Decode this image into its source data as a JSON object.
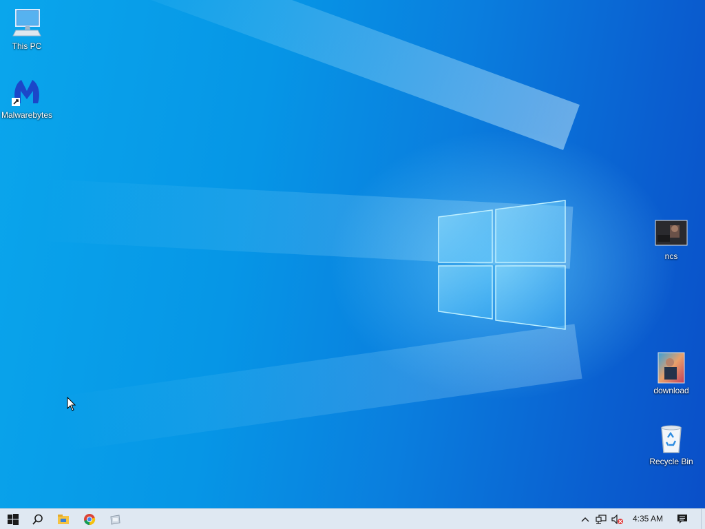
{
  "desktop": {
    "icons": [
      {
        "label": "This PC",
        "icon": "computer-monitor-icon"
      },
      {
        "label": "Malwarebytes",
        "icon": "malwarebytes-icon"
      },
      {
        "label": "ncs",
        "icon": "image-thumbnail-icon"
      },
      {
        "label": "download",
        "icon": "image-thumbnail-icon"
      },
      {
        "label": "Recycle Bin",
        "icon": "recycle-bin-icon"
      }
    ],
    "wallpaper": {
      "style": "windows-10-hero",
      "accent": "#0a7ede"
    }
  },
  "taskbar": {
    "start_icon": "windows-logo-icon",
    "search_icon": "search-icon",
    "pinned": [
      {
        "icon": "file-explorer-icon"
      },
      {
        "icon": "chrome-icon"
      },
      {
        "icon": "app-window-icon"
      }
    ],
    "tray": {
      "show_hidden_icon": "chevron-up-icon",
      "network_icon": "network-icon",
      "volume_icon": "volume-muted-icon",
      "clock": "4:35 AM",
      "notification_icon": "action-center-icon"
    },
    "background": "#dfe8f2"
  }
}
